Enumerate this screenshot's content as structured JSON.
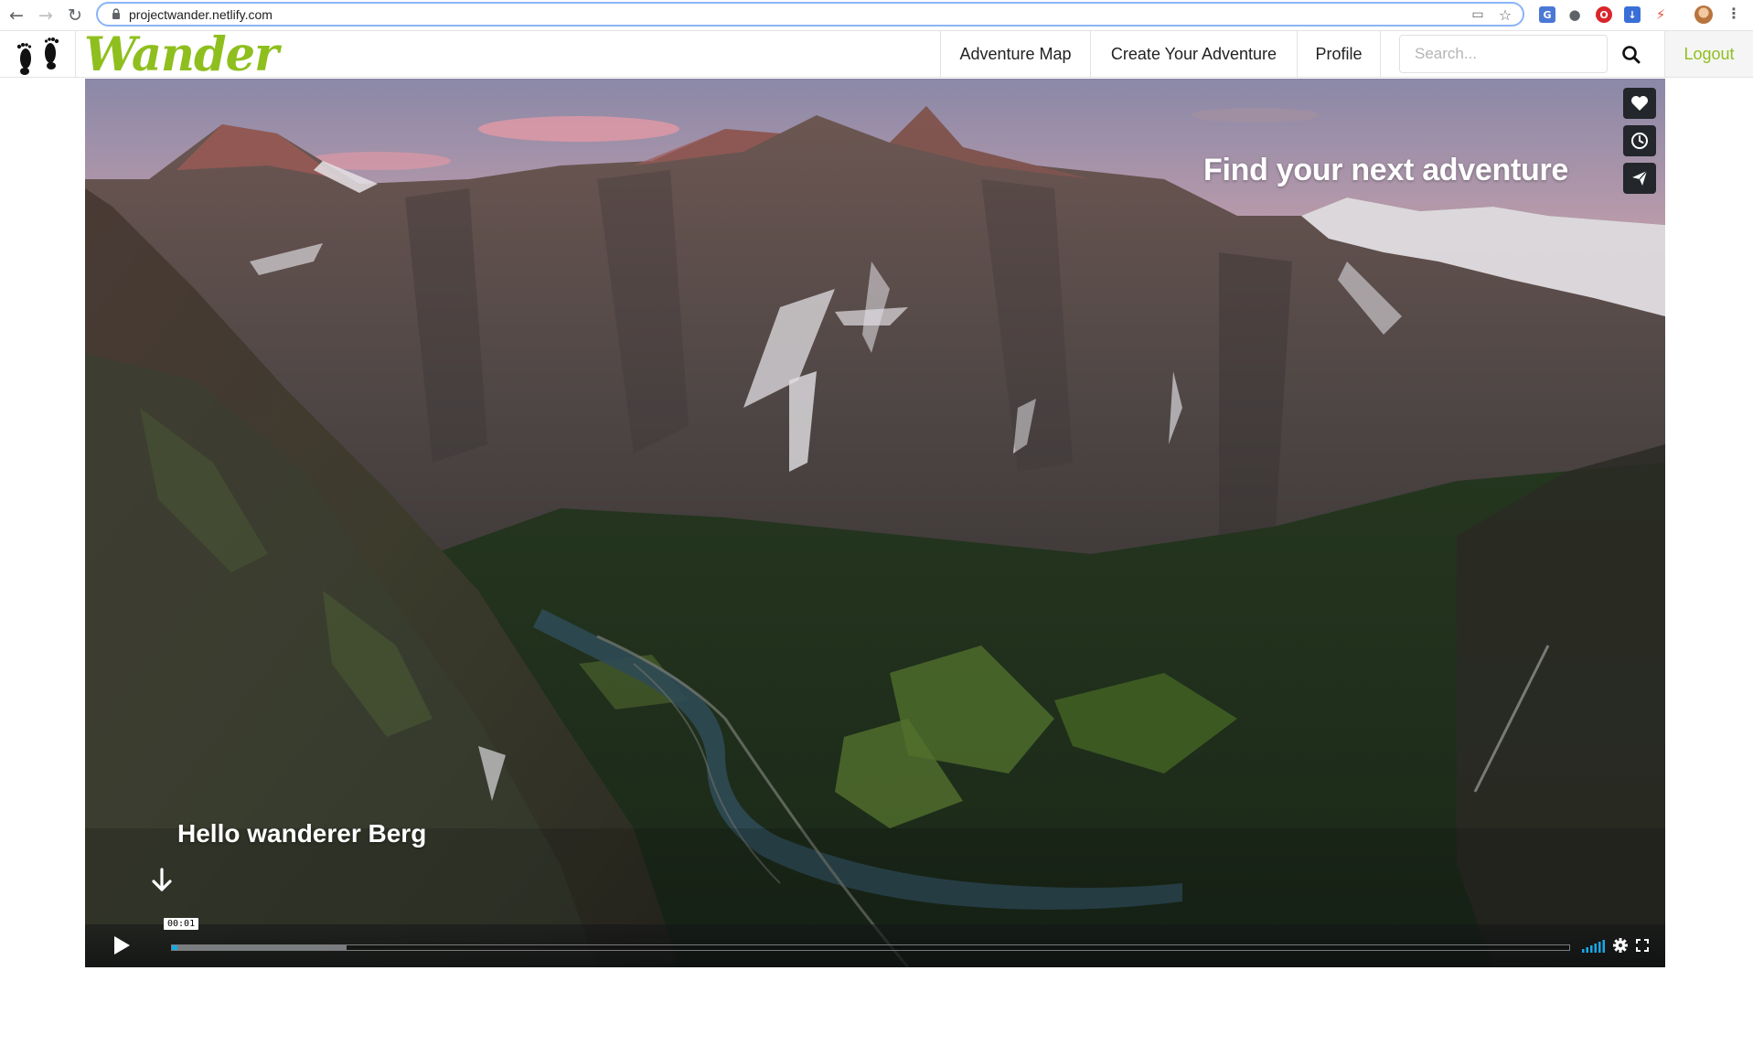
{
  "browser": {
    "url": "projectwander.netlify.com"
  },
  "navbar": {
    "brand": "Wander",
    "links": [
      {
        "label": "Adventure Map"
      },
      {
        "label": "Create Your Adventure"
      },
      {
        "label": "Profile"
      }
    ],
    "search_placeholder": "Search...",
    "search_value": "",
    "logout_label": "Logout",
    "brand_color": "#8fbf1e"
  },
  "hero": {
    "headline": "Find your next adventure",
    "greeting": "Hello wanderer Berg",
    "side_actions": [
      "heart-icon",
      "clock-icon",
      "send-icon"
    ],
    "scroll_icon": "arrow-down-icon"
  },
  "player": {
    "timecode": "00:01",
    "played_fraction": 0.004,
    "buffered_fraction": 0.125,
    "accent_color": "#19a8e6"
  }
}
